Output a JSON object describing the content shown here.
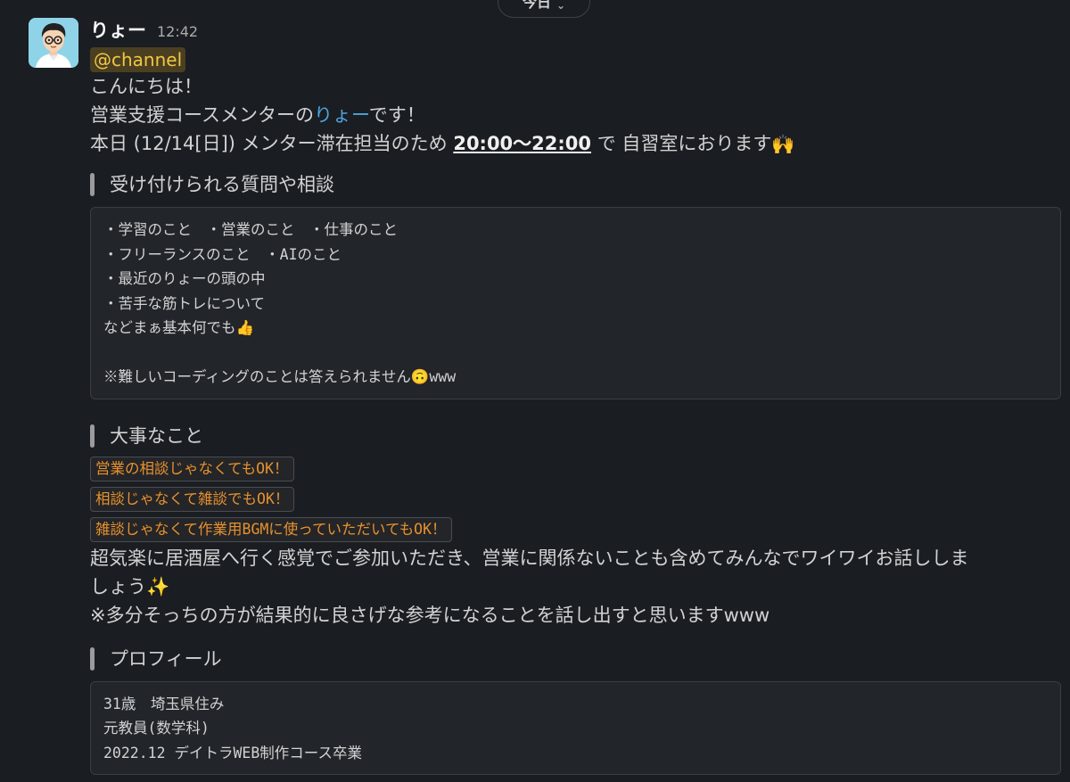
{
  "date_divider": {
    "label": "今日",
    "chevron": "chevron-down-icon"
  },
  "message": {
    "author": "りょー",
    "time": "12:42",
    "mention": "@channel",
    "greeting": "こんにちは！",
    "intro_prefix": "営業支援コースメンターの",
    "intro_name": "りょー",
    "intro_suffix": "です！",
    "schedule_prefix": "本日 (12/14[日]) メンター滞在担当のため ",
    "schedule_time": "20:00〜22:00",
    "schedule_suffix": " で 自習室におります",
    "schedule_emoji": "🙌"
  },
  "sections": {
    "questions": {
      "title": "受け付けられる質問や相談",
      "lines": [
        "・学習のこと　・営業のこと　・仕事のこと",
        "・フリーランスのこと　・AIのこと",
        "・最近のりょーの頭の中",
        "・苦手な筋トレについて",
        "などまぁ基本何でも👍",
        "",
        "※難しいコーディングのことは答えられません🙃www"
      ]
    },
    "important": {
      "title": "大事なこと",
      "codes": [
        "営業の相談じゃなくてもOK！",
        "相談じゃなくて雑談でもOK！",
        "雑談じゃなくて作業用BGMに使っていただいてもOK！"
      ],
      "body_line1": "超気楽に居酒屋へ行く感覚でご参加いただき、営業に関係ないことも含めてみんなでワイワイお話ししま",
      "body_line2": "しょう✨",
      "note": "※多分そっちの方が結果的に良さげな参考になることを話し出すと思いますwww"
    },
    "profile": {
      "title": "プロフィール",
      "lines": [
        "31歳　埼玉県住み",
        "元教員(数学科)",
        "2022.12 デイトラWEB制作コース卒業"
      ]
    }
  },
  "colors": {
    "background": "#1a1d21",
    "mention_text": "#f2c744",
    "link": "#4ea3e0",
    "code_text": "#e8912d"
  }
}
